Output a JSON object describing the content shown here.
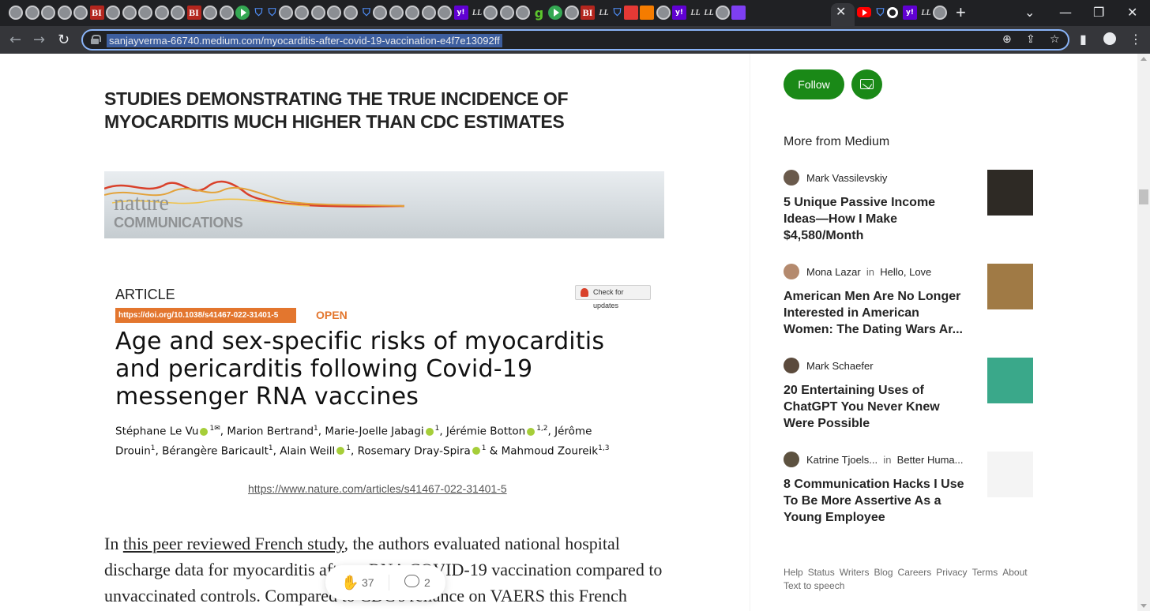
{
  "browser": {
    "url": "sanjayverma-66740.medium.com/myocarditis-after-covid-19-vaccination-e4f7e13092ff",
    "tab_icons": [
      "globe",
      "globe",
      "globe",
      "globe",
      "globe",
      "bi",
      "globe",
      "globe",
      "globe",
      "globe",
      "globe",
      "bi",
      "globe",
      "globe",
      "play",
      "shield",
      "shield",
      "globe",
      "globe",
      "globe",
      "globe",
      "globe",
      "shield",
      "globe",
      "globe",
      "globe",
      "globe",
      "globe",
      "yahoo",
      "ll",
      "globe",
      "globe",
      "globe",
      "g",
      "play",
      "globe",
      "bi",
      "ll",
      "shield",
      "red",
      "orange",
      "globe",
      "yahoo",
      "ll",
      "ll",
      "globe",
      "purple"
    ],
    "tab_labels": {
      "bi": "BI",
      "yahoo": "y!",
      "ll": "LL",
      "g": "g"
    },
    "extra_tabs": [
      "yt",
      "shield",
      "ring",
      "yahoo",
      "ll",
      "globe"
    ],
    "window_controls": {
      "tab_search": "⌄",
      "minimize": "—",
      "maximize": "❐",
      "close": "✕"
    },
    "nav": {
      "back": "←",
      "forward": "→",
      "reload": "↻",
      "new_tab": "+",
      "tab_close": "✕"
    },
    "omni_icons": {
      "zoom": "⊕",
      "share": "⇪",
      "bookmark": "☆"
    },
    "toolbar_icons": {
      "side_panel": "▮",
      "menu": "⋮"
    }
  },
  "article": {
    "headline": "STUDIES DEMONSTRATING THE TRUE INCIDENCE OF MYOCARDITIS MUCH HIGHER THAN CDC ESTIMATES",
    "banner": {
      "nature": "nature",
      "communications": "COMMUNICATIONS"
    },
    "kicker": "ARTICLE",
    "check_updates": "Check for updates",
    "doi": "https://doi.org/10.1038/s41467-022-31401-5",
    "open_label": "OPEN",
    "paper_title": "Age and sex-specific risks of myocarditis and pericarditis following Covid-19 messenger RNA vaccines",
    "authors": [
      {
        "name": "Stéphane Le Vu",
        "sup": "1✉",
        "orcid": true
      },
      {
        "name": "Marion Bertrand",
        "sup": "1",
        "orcid": false
      },
      {
        "name": "Marie-Joelle Jabagi",
        "sup": "1",
        "orcid": true
      },
      {
        "name": "Jérémie Botton",
        "sup": "1,2",
        "orcid": true
      },
      {
        "name": "Jérôme Drouin",
        "sup": "1",
        "orcid": false
      },
      {
        "name": "Bérangère Baricault",
        "sup": "1",
        "orcid": false
      },
      {
        "name": "Alain Weill",
        "sup": "1",
        "orcid": true
      },
      {
        "name": "Rosemary Dray-Spira",
        "sup": "1",
        "orcid": true
      },
      {
        "name": "Mahmoud Zoureik",
        "sup": "1,3",
        "orcid": false
      }
    ],
    "source_link": "https://www.nature.com/articles/s41467-022-31401-5",
    "body": {
      "prefix": "In ",
      "link_text": "this peer reviewed French study",
      "rest": ", the authors evaluated national hospital discharge data for myocarditis after mRNA COVID-19 vaccination compared to unvaccinated controls. Compared to CDC's reliance on VAERS this French"
    },
    "claps": "37",
    "comments": "2",
    "clap_icon": "✋"
  },
  "sidebar": {
    "follow_label": "Follow",
    "more_heading": "More from Medium",
    "stories": [
      {
        "author": "Mark Vassilevskiy",
        "publication": "",
        "title": "5 Unique Passive Income Ideas—How I Make $4,580/Month",
        "avatar_color": "#6a5a4c",
        "thumb_color": "#2e2a25"
      },
      {
        "author": "Mona Lazar",
        "publication": "Hello, Love",
        "title": "American Men Are No Longer Interested in American Women: The Dating Wars Ar...",
        "avatar_color": "#b48a6e",
        "thumb_color": "#a07a45"
      },
      {
        "author": "Mark Schaefer",
        "publication": "",
        "title": "20 Entertaining Uses of ChatGPT You Never Knew Were Possible",
        "avatar_color": "#5b4a3c",
        "thumb_color": "#3aa88a"
      },
      {
        "author": "Katrine Tjoels...",
        "publication": "Better Huma...",
        "title": "8 Communication Hacks I Use To Be More Assertive As a Young Employee",
        "avatar_color": "#5d5240",
        "thumb_color": "#f4f4f4"
      }
    ],
    "in_word": "in",
    "footer": [
      "Help",
      "Status",
      "Writers",
      "Blog",
      "Careers",
      "Privacy",
      "Terms",
      "About",
      "Text to speech"
    ]
  },
  "colors": {
    "medium_green": "#1a8917",
    "nature_orange": "#e3762e",
    "omnibox_focus": "#8ab4f8"
  }
}
